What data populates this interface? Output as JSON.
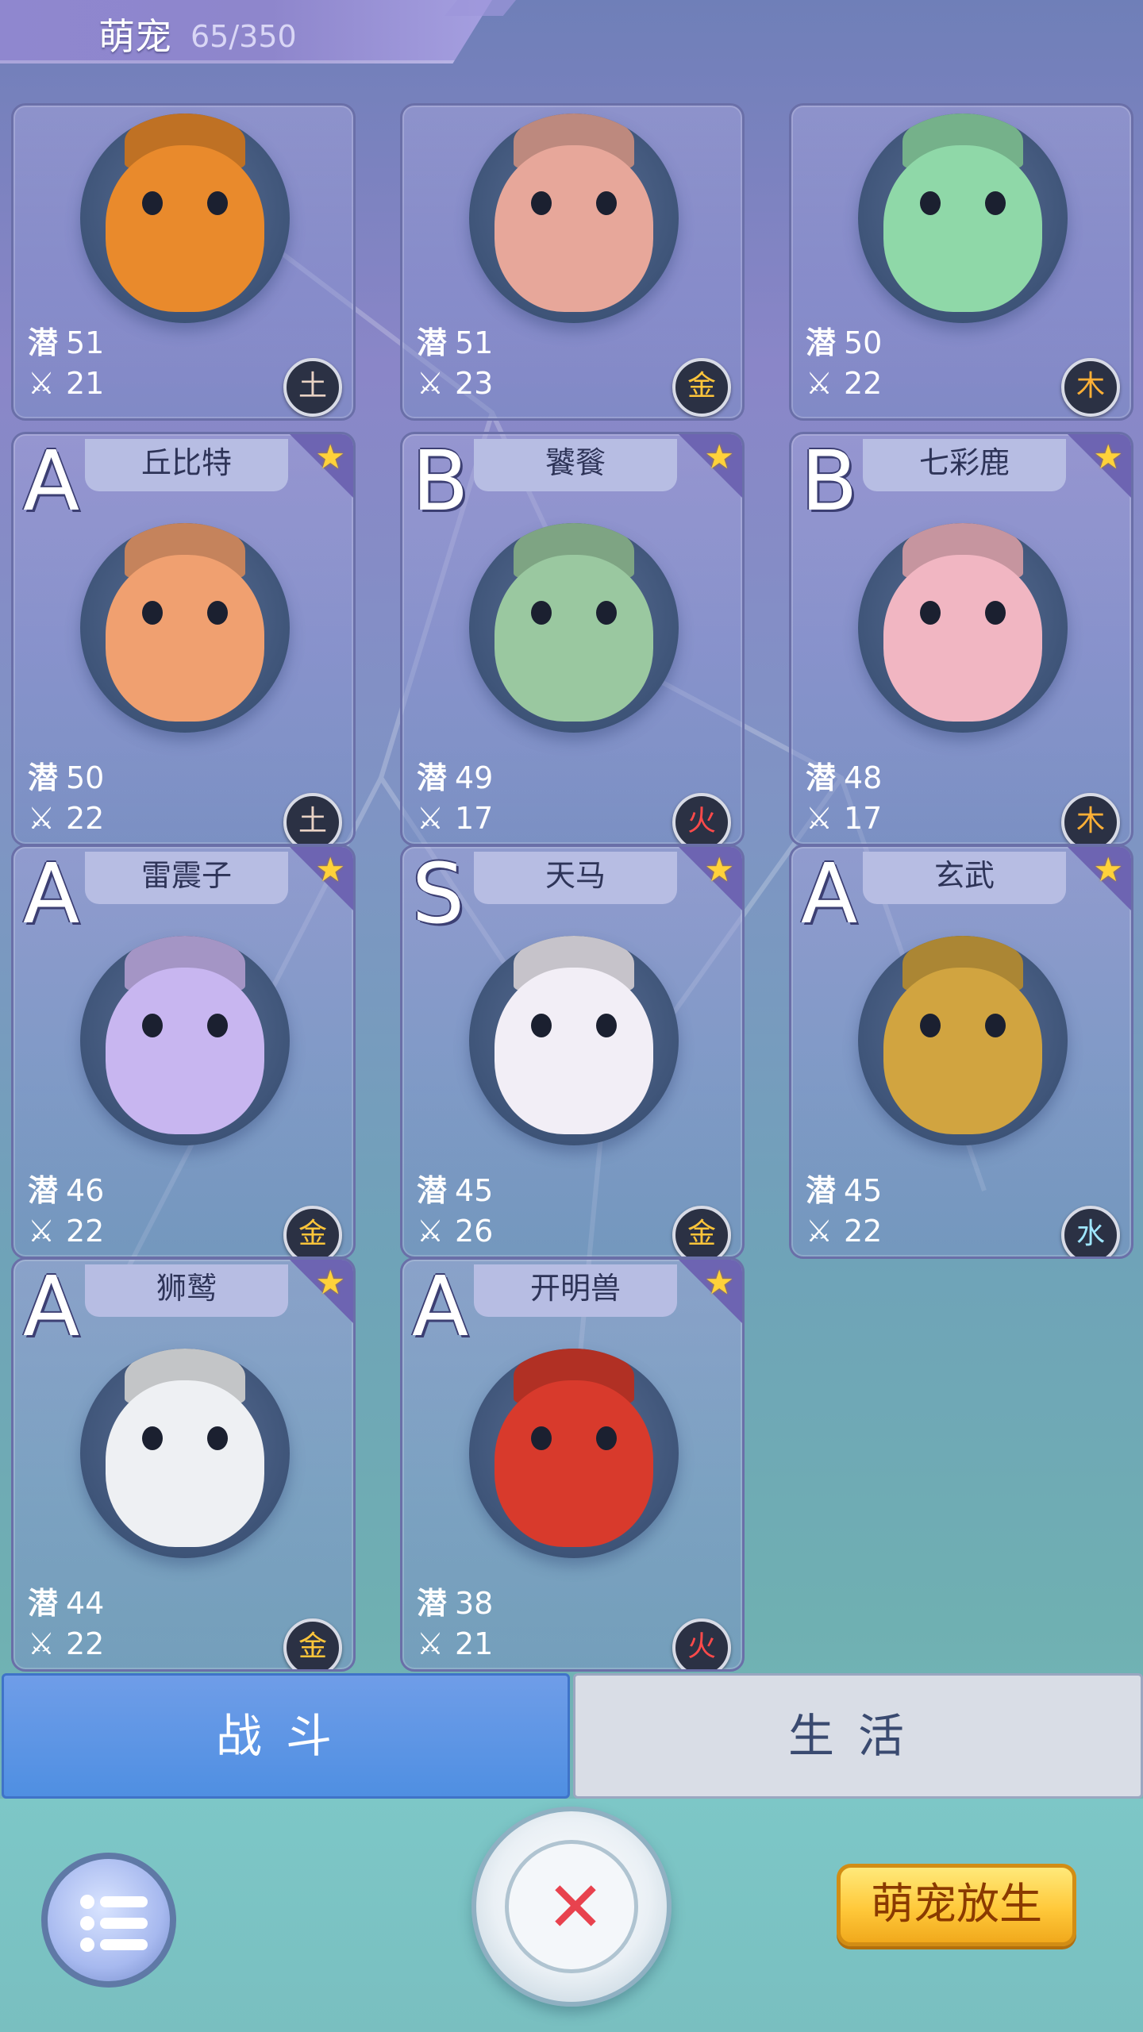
{
  "header": {
    "title": "萌宠",
    "count": "65/350"
  },
  "stat_icons": {
    "potential": "潜",
    "attack": "attack-swords-icon"
  },
  "pets": [
    {
      "grade": "",
      "name": "",
      "potential": "51",
      "attack": "21",
      "element": "土",
      "element_type": "earth",
      "color": "#e98a2c"
    },
    {
      "grade": "",
      "name": "",
      "potential": "51",
      "attack": "23",
      "element": "金",
      "element_type": "gold",
      "color": "#e7a79a"
    },
    {
      "grade": "",
      "name": "",
      "potential": "50",
      "attack": "22",
      "element": "木",
      "element_type": "wood",
      "color": "#8fd8a8"
    },
    {
      "grade": "A",
      "name": "丘比特",
      "potential": "50",
      "attack": "22",
      "element": "土",
      "element_type": "earth",
      "color": "#f0a070"
    },
    {
      "grade": "B",
      "name": "饕餮",
      "potential": "49",
      "attack": "17",
      "element": "火",
      "element_type": "fire",
      "color": "#9ac8a0"
    },
    {
      "grade": "B",
      "name": "七彩鹿",
      "potential": "48",
      "attack": "17",
      "element": "木",
      "element_type": "wood",
      "color": "#f1b6c2"
    },
    {
      "grade": "A",
      "name": "雷震子",
      "potential": "46",
      "attack": "22",
      "element": "金",
      "element_type": "gold",
      "color": "#c8b6f0"
    },
    {
      "grade": "S",
      "name": "天马",
      "potential": "45",
      "attack": "26",
      "element": "金",
      "element_type": "gold",
      "color": "#f2eef6"
    },
    {
      "grade": "A",
      "name": "玄武",
      "potential": "45",
      "attack": "22",
      "element": "水",
      "element_type": "water",
      "color": "#d1a440"
    },
    {
      "grade": "A",
      "name": "狮鹫",
      "potential": "44",
      "attack": "22",
      "element": "金",
      "element_type": "gold",
      "color": "#eef0f3"
    },
    {
      "grade": "A",
      "name": "开明兽",
      "potential": "38",
      "attack": "21",
      "element": "火",
      "element_type": "fire",
      "color": "#d83a2c"
    }
  ],
  "tabs": {
    "battle": "战斗",
    "life": "生活"
  },
  "buttons": {
    "release": "萌宠放生",
    "close": "✕"
  }
}
